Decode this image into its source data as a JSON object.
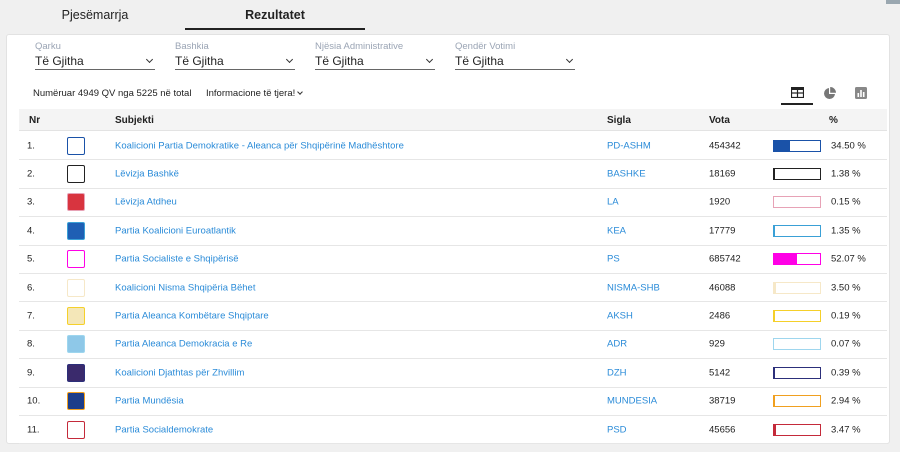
{
  "tabs": {
    "participation": "Pjesëmarrja",
    "results": "Rezultatet"
  },
  "filters": [
    {
      "label": "Qarku",
      "value": "Të Gjitha"
    },
    {
      "label": "Bashkia",
      "value": "Të Gjitha"
    },
    {
      "label": "Njësia Administrative",
      "value": "Të Gjitha"
    },
    {
      "label": "Qendër Votimi",
      "value": "Të Gjitha"
    }
  ],
  "summary": {
    "counted": "Numëruar 4949 QV nga 5225 në total",
    "more_info": "Informacione të tjera!"
  },
  "table": {
    "headers": {
      "nr": "Nr",
      "subject": "Subjekti",
      "sigla": "Sigla",
      "votes": "Vota",
      "pct": "%"
    },
    "rows": [
      {
        "nr": "1.",
        "subject": "Koalicioni Partia Demokratike - Aleanca për Shqipërinë Madhështore",
        "sigla": "PD-ASHM",
        "votes": "454342",
        "pct": "34.50 %",
        "share": 0.345,
        "color": "#1a52a8",
        "logo": "pd-logo-icon",
        "logo_bg": "#ffffff"
      },
      {
        "nr": "2.",
        "subject": "Lëvizja Bashkë",
        "sigla": "BASHKE",
        "votes": "18169",
        "pct": "1.38 %",
        "share": 0.0138,
        "color": "#222222",
        "logo": "bashke-logo-icon",
        "logo_bg": "#ffffff"
      },
      {
        "nr": "3.",
        "subject": "Lëvizja Atdheu",
        "sigla": "LA",
        "votes": "1920",
        "pct": "0.15 %",
        "share": 0.0015,
        "color": "#e7a2b6",
        "logo": "la-logo-icon",
        "logo_bg": "#d8343f"
      },
      {
        "nr": "4.",
        "subject": "Partia Koalicioni Euroatlantik",
        "sigla": "KEA",
        "votes": "17779",
        "pct": "1.35 %",
        "share": 0.0135,
        "color": "#3aa0d6",
        "logo": "kea-logo-icon",
        "logo_bg": "#1f5fb4"
      },
      {
        "nr": "5.",
        "subject": "Partia Socialiste e Shqipërisë",
        "sigla": "PS",
        "votes": "685742",
        "pct": "52.07 %",
        "share": 0.5207,
        "color": "#ff00e6",
        "logo": "ps-logo-icon",
        "logo_bg": "#ffffff"
      },
      {
        "nr": "6.",
        "subject": "Koalicioni Nisma Shqipëria Bëhet",
        "sigla": "NISMA-SHB",
        "votes": "46088",
        "pct": "3.50 %",
        "share": 0.035,
        "color": "#f6e8c8",
        "logo": "nisma-logo-icon",
        "logo_bg": "#ffffff"
      },
      {
        "nr": "7.",
        "subject": "Partia Aleanca Kombëtare Shqiptare",
        "sigla": "AKSH",
        "votes": "2486",
        "pct": "0.19 %",
        "share": 0.0019,
        "color": "#f5d02a",
        "logo": "aksh-logo-icon",
        "logo_bg": "#f4e7b8"
      },
      {
        "nr": "8.",
        "subject": "Partia Aleanca Demokracia e Re",
        "sigla": "ADR",
        "votes": "929",
        "pct": "0.07 %",
        "share": 0.0007,
        "color": "#9ed6ee",
        "logo": "adr-logo-icon",
        "logo_bg": "#8ec8e8"
      },
      {
        "nr": "9.",
        "subject": "Koalicioni Djathtas për Zhvillim",
        "sigla": "DZH",
        "votes": "5142",
        "pct": "0.39 %",
        "share": 0.0039,
        "color": "#2c2f7a",
        "logo": "dzh-logo-icon",
        "logo_bg": "#3a2a6c"
      },
      {
        "nr": "10.",
        "subject": "Partia Mundësia",
        "sigla": "MUNDESIA",
        "votes": "38719",
        "pct": "2.94 %",
        "share": 0.0294,
        "color": "#f0a020",
        "logo": "mundesia-logo-icon",
        "logo_bg": "#1c3d8a"
      },
      {
        "nr": "11.",
        "subject": "Partia Socialdemokrate",
        "sigla": "PSD",
        "votes": "45656",
        "pct": "3.47 %",
        "share": 0.0347,
        "color": "#c42a3a",
        "logo": "psd-logo-icon",
        "logo_bg": "#ffffff"
      }
    ]
  }
}
